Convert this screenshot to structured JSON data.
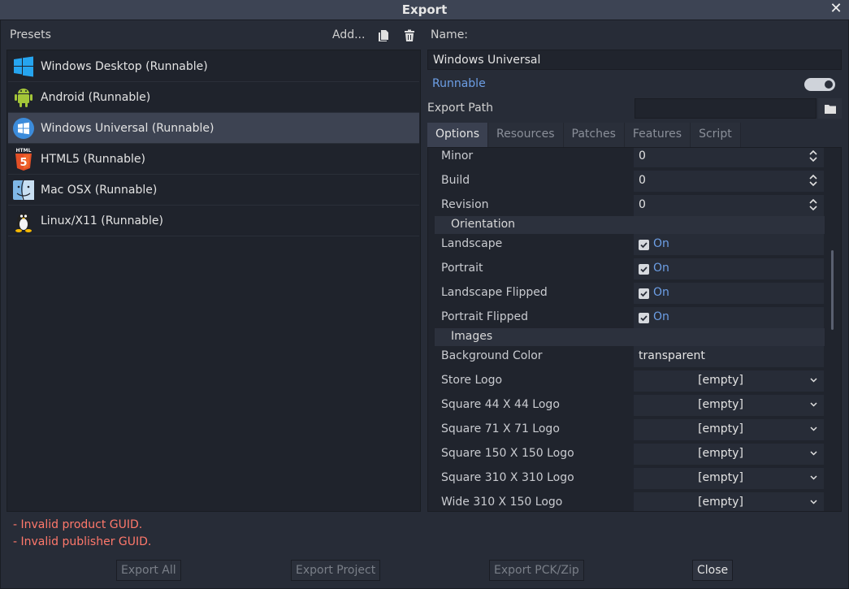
{
  "window": {
    "title": "Export"
  },
  "presets": {
    "label": "Presets",
    "add_label": "Add...",
    "items": [
      {
        "label": "Windows Desktop (Runnable)",
        "icon": "windows-icon"
      },
      {
        "label": "Android (Runnable)",
        "icon": "android-icon"
      },
      {
        "label": "Windows Universal (Runnable)",
        "icon": "windows-universal-icon"
      },
      {
        "label": "HTML5 (Runnable)",
        "icon": "html5-icon"
      },
      {
        "label": "Mac OSX (Runnable)",
        "icon": "mac-osx-icon"
      },
      {
        "label": "Linux/X11 (Runnable)",
        "icon": "linux-icon"
      }
    ]
  },
  "details": {
    "name_label": "Name:",
    "name_value": "Windows Universal",
    "runnable_label": "Runnable",
    "export_path_label": "Export Path",
    "export_path_value": ""
  },
  "tabs": [
    "Options",
    "Resources",
    "Patches",
    "Features",
    "Script"
  ],
  "options": {
    "minor_label": "Minor",
    "minor_value": "0",
    "build_label": "Build",
    "build_value": "0",
    "revision_label": "Revision",
    "revision_value": "0",
    "orientation_section": "Orientation",
    "landscape_label": "Landscape",
    "portrait_label": "Portrait",
    "landscape_flipped_label": "Landscape Flipped",
    "portrait_flipped_label": "Portrait Flipped",
    "on_text": "On",
    "images_section": "Images",
    "background_color_label": "Background Color",
    "background_color_value": "transparent",
    "store_logo_label": "Store Logo",
    "square44_label": "Square 44 X 44 Logo",
    "square71_label": "Square 71 X 71 Logo",
    "square150_label": "Square 150 X 150 Logo",
    "square310_label": "Square 310 X 310 Logo",
    "wide310_label": "Wide 310 X 150 Logo",
    "empty_value": "[empty]"
  },
  "errors": {
    "product_guid": "- Invalid product GUID.",
    "publisher_guid": "- Invalid publisher GUID."
  },
  "buttons": {
    "export_all": "Export All",
    "export_project": "Export Project",
    "export_pck": "Export PCK/Zip",
    "close": "Close"
  },
  "colors": {
    "accent": "#6d9fe6",
    "error": "#ff786b",
    "selection": "#3d4352"
  }
}
